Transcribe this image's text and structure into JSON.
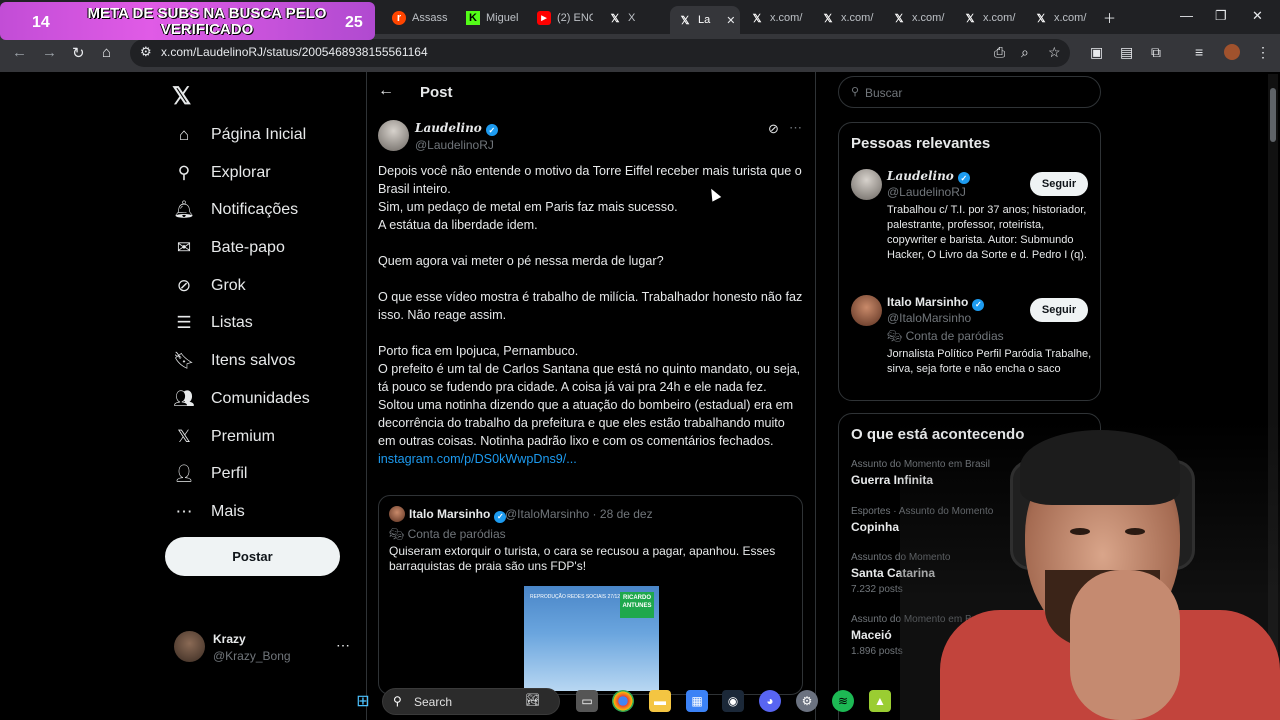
{
  "browser": {
    "overlay": {
      "count_left": "14",
      "banner_text": "META DE SUBS NA BUSCA PELO VERIFICADO",
      "count_right": "25"
    },
    "tabs": [
      {
        "label": "Reddit",
        "icon": "reddit-icon"
      },
      {
        "label": "Assass",
        "icon": "reddit-icon"
      },
      {
        "label": "Miguel",
        "icon": "kick-icon"
      },
      {
        "label": "(2) ENC",
        "icon": "youtube-icon"
      },
      {
        "label": "X",
        "icon": "x-icon"
      },
      {
        "label": "La",
        "icon": "x-icon",
        "active": true
      },
      {
        "label": "x.com/",
        "icon": "x-icon"
      },
      {
        "label": "x.com/",
        "icon": "x-icon"
      },
      {
        "label": "x.com/",
        "icon": "x-icon"
      },
      {
        "label": "x.com/",
        "icon": "x-icon"
      },
      {
        "label": "x.com/",
        "icon": "x-icon"
      }
    ],
    "url": "x.com/LaudelinoRJ/status/2005468938155561164"
  },
  "nav": {
    "items": [
      {
        "label": "Página Inicial",
        "icon": "home-icon"
      },
      {
        "label": "Explorar",
        "icon": "search-icon"
      },
      {
        "label": "Notificações",
        "icon": "bell-icon"
      },
      {
        "label": "Bate-papo",
        "icon": "mail-icon"
      },
      {
        "label": "Grok",
        "icon": "grok-icon"
      },
      {
        "label": "Listas",
        "icon": "list-icon"
      },
      {
        "label": "Itens salvos",
        "icon": "bookmark-icon"
      },
      {
        "label": "Comunidades",
        "icon": "people-icon"
      },
      {
        "label": "Premium",
        "icon": "x-icon"
      },
      {
        "label": "Perfil",
        "icon": "person-icon"
      },
      {
        "label": "Mais",
        "icon": "more-icon"
      }
    ],
    "post_button": "Postar",
    "account": {
      "name": "Krazy",
      "handle": "@Krazy_Bong"
    }
  },
  "post": {
    "header": "Post",
    "author": {
      "name": "Laudelino",
      "handle": "@LaudelinoRJ"
    },
    "lines": [
      "Depois você não entende o motivo da Torre Eiffel receber mais turista que o Brasil inteiro.",
      "Sim, um pedaço de metal em Paris faz mais sucesso.",
      "A estátua da liberdade idem.",
      "",
      "Quem agora vai meter o pé nessa merda de lugar?",
      "",
      "O que esse vídeo mostra é trabalho de milícia. Trabalhador honesto não faz isso. Não reage assim.",
      "",
      "Porto fica em Ipojuca, Pernambuco.",
      "O prefeito é um tal de Carlos Santana que está no quinto mandato, ou seja, tá pouco se fudendo pra cidade. A coisa já vai pra 24h e ele nada fez. Soltou uma notinha dizendo que a atuação do bombeiro (estadual) era em decorrência do trabalho da prefeitura e que eles estão trabalhando muito em outras coisas. Notinha padrão lixo e com os comentários fechados."
    ],
    "link": "instagram.com/p/DS0kWwpDns9/...",
    "quote": {
      "name": "Italo Marsinho",
      "handle": "@ItaloMarsinho",
      "date": "28 de dez",
      "label": "Conta de paródias",
      "text": "Quiseram extorquir o turista, o cara se recusou a pagar, apanhou. Esses barraquistas de praia são uns FDP's!",
      "media_caption": "REPRODUÇÃO REDES SOCIAIS 27/12/2025",
      "media_label": "RICARDO ANTUNES"
    }
  },
  "sidebar": {
    "search_placeholder": "Buscar",
    "relevant_title": "Pessoas relevantes",
    "people": [
      {
        "name": "Laudelino",
        "handle": "@LaudelinoRJ",
        "button": "Seguir",
        "bio": "Trabalhou c/ T.I. por 37 anos; historiador, palestrante, professor, roteirista, copywriter e barista. Autor: Submundo Hacker, O Livro da Sorte e d. Pedro I (q)."
      },
      {
        "name": "Italo Marsinho",
        "handle": "@ItaloMarsinho",
        "button": "Seguir",
        "parody": "Conta de paródias",
        "bio": "Jornalista Político Perfil Paródia Trabalhe, sirva, seja forte e não encha o saco"
      }
    ],
    "trends_title": "O que está acontecendo",
    "trends": [
      {
        "category": "Assunto do Momento em Brasil",
        "name": "Guerra Infinita",
        "count": ""
      },
      {
        "category": "Esportes · Assunto do Momento",
        "name": "Copinha",
        "count": ""
      },
      {
        "category": "Assuntos do Momento",
        "name": "Santa Catarina",
        "count": "7.232 posts"
      },
      {
        "category": "Assunto do Momento em Brasil",
        "name": "Maceió",
        "count": "1.896 posts"
      }
    ]
  },
  "taskbar": {
    "search_label": "Search"
  },
  "colors": {
    "accent": "#1d9bf0",
    "background": "#000000",
    "banner": "#d454e0"
  }
}
